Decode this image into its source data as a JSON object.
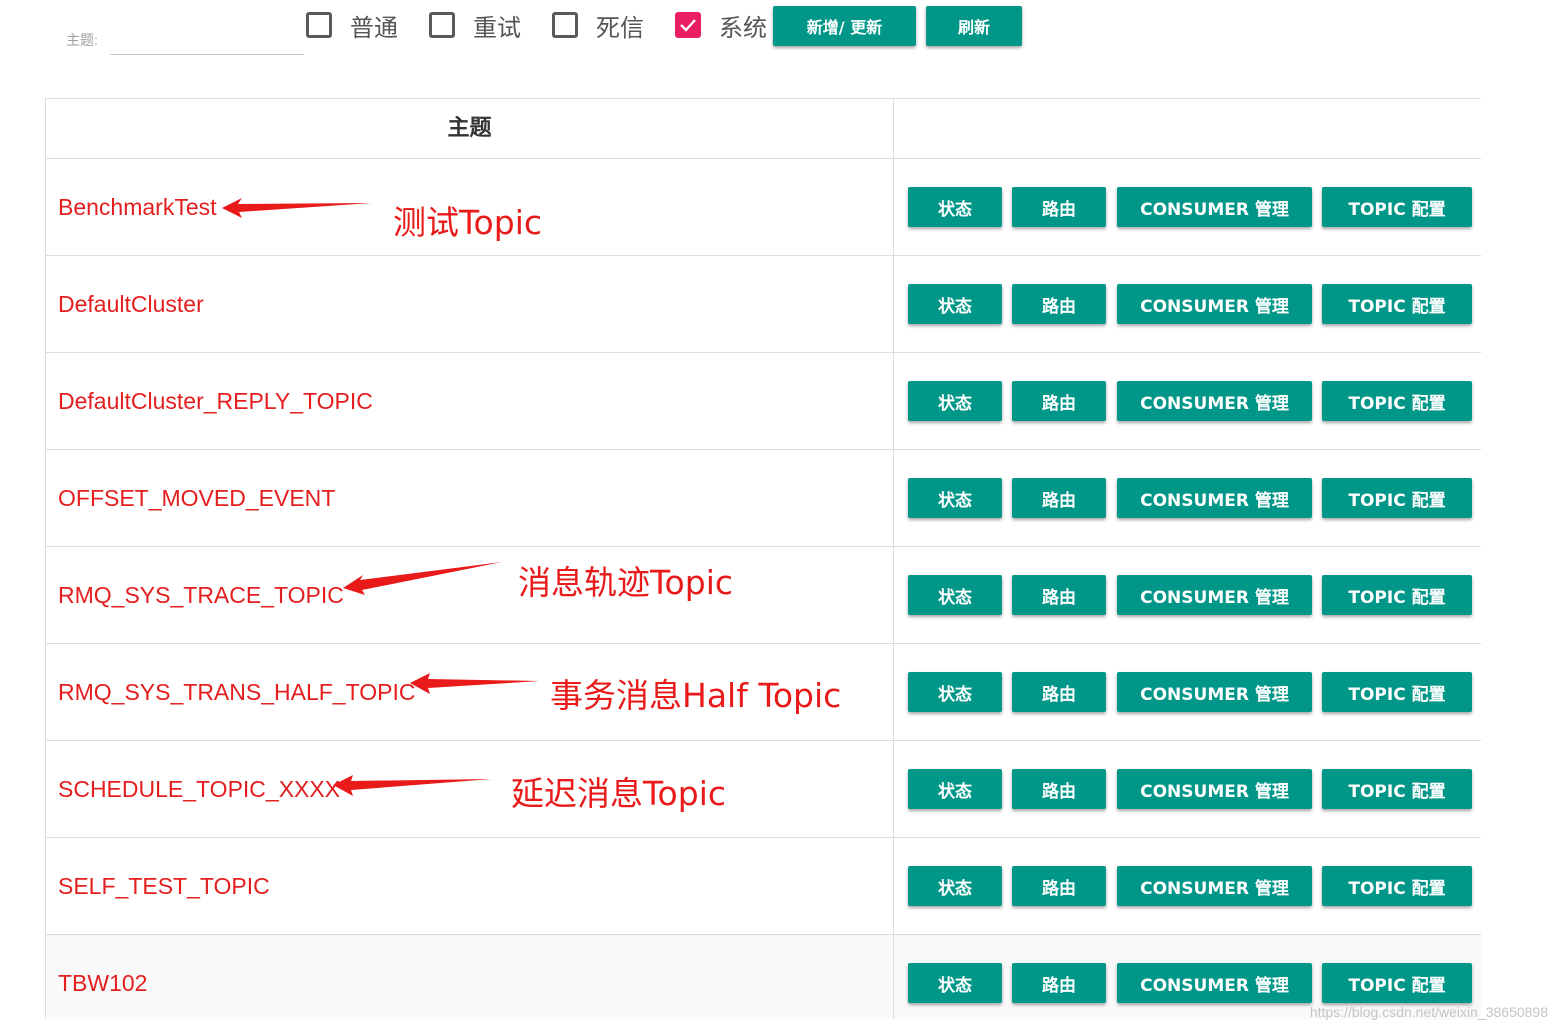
{
  "filter": {
    "topic_label": "主题:",
    "topic_value": "",
    "checkboxes": [
      {
        "label": "普通",
        "checked": false
      },
      {
        "label": "重试",
        "checked": false
      },
      {
        "label": "死信",
        "checked": false
      },
      {
        "label": "系统",
        "checked": true
      }
    ],
    "add_update_label": "新增/ 更新",
    "refresh_label": "刷新"
  },
  "table": {
    "header_topic": "主题",
    "header_actions": "",
    "action_labels": {
      "status": "状态",
      "route": "路由",
      "consumer": "CONSUMER 管理",
      "config": "TOPIC 配置"
    },
    "rows": [
      {
        "name": "BenchmarkTest"
      },
      {
        "name": "DefaultCluster"
      },
      {
        "name": "DefaultCluster_REPLY_TOPIC"
      },
      {
        "name": "OFFSET_MOVED_EVENT"
      },
      {
        "name": "RMQ_SYS_TRACE_TOPIC"
      },
      {
        "name": "RMQ_SYS_TRANS_HALF_TOPIC"
      },
      {
        "name": "SCHEDULE_TOPIC_XXXX"
      },
      {
        "name": "SELF_TEST_TOPIC"
      },
      {
        "name": "TBW102"
      }
    ]
  },
  "annotations": [
    {
      "text": "测试Topic"
    },
    {
      "text": "消息轨迹Topic"
    },
    {
      "text": "事务消息Half Topic"
    },
    {
      "text": "延迟消息Topic"
    }
  ],
  "watermark": "https://blog.csdn.net/weixin_38650898",
  "colors": {
    "accent": "#009688",
    "checkbox_checked": "#e91e63",
    "topic_link": "#e41e1e",
    "annotation": "#e81a1a"
  }
}
